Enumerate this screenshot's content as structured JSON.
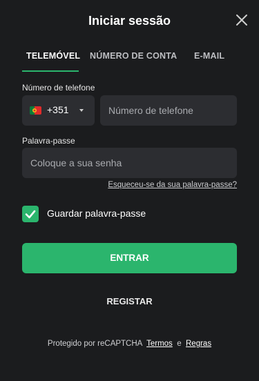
{
  "header": {
    "title": "Iniciar sessão",
    "close_icon": "close-icon"
  },
  "tabs": [
    {
      "label": "TELEMÓVEL",
      "active": true
    },
    {
      "label": "NÚMERO DE CONTA",
      "active": false
    },
    {
      "label": "E-MAIL",
      "active": false
    }
  ],
  "phone": {
    "label": "Número de telefone",
    "country_code": "+351",
    "country_flag": "portugal-flag-icon",
    "placeholder": "Número de telefone",
    "value": ""
  },
  "password": {
    "label": "Palavra-passe",
    "placeholder": "Coloque a sua senha",
    "value": "",
    "forgot_link": "Esqueceu-se da sua palavra-passe?"
  },
  "remember": {
    "label": "Guardar palavra-passe",
    "checked": true
  },
  "buttons": {
    "login": "ENTRAR",
    "register": "REGISTAR"
  },
  "footer": {
    "prefix": "Protegido por reCAPTCHA",
    "terms": "Termos",
    "and": "e",
    "rules": "Regras"
  },
  "colors": {
    "background": "#1b1c1e",
    "accent": "#2bb56d",
    "field": "#2c2d31"
  }
}
